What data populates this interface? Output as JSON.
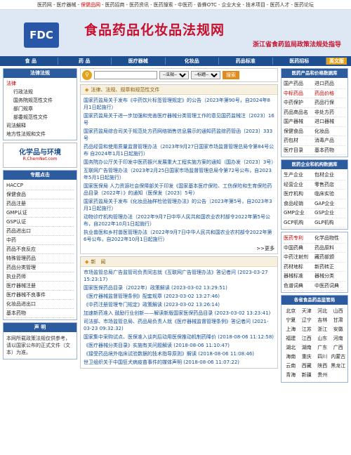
{
  "topnav": [
    "医药网",
    "医疗器械",
    "保健品网",
    "医药招商",
    "医药资讯",
    "医药搜索",
    "中医药",
    "香蜂OTC",
    "企业大全",
    "技术项目",
    "医药人才",
    "医药论坛"
  ],
  "banner": {
    "logo": "FDC",
    "title": "食品药品化妆品法规网",
    "slogan": "浙江省食药监局政策法规处指导"
  },
  "mainnav": [
    "食 品",
    "药 品",
    "医疗器械",
    "化妆品",
    "药品标准",
    "医药招标",
    "英文版"
  ],
  "left": {
    "law_title": "法律法规",
    "law_items": [
      {
        "t": "法律",
        "cls": "hdr"
      },
      {
        "t": "行政法规",
        "cls": "sub"
      },
      {
        "t": "国务院规范性文件",
        "cls": "sub"
      },
      {
        "t": "部门规章",
        "cls": "sub"
      },
      {
        "t": "部委规范性文件",
        "cls": "sub"
      },
      {
        "t": "司法解释",
        "cls": ""
      },
      {
        "t": "地方性法规和文件",
        "cls": ""
      }
    ],
    "ad_line1": "化学品与环境",
    "ad_line2": "R.ChemNet.com",
    "topic_title": "专题点击",
    "topics": [
      "HACCP",
      "保健食品",
      "药品注册",
      "GMP认证",
      "GSP认证",
      "药品进出口",
      "中药",
      "药品不良反应",
      "特殊管理药品",
      "药品分类管理",
      "执业药师",
      "医疗器械注册",
      "医疗器械不良事件",
      "化妆品进出口",
      "基本药物"
    ],
    "stmt_title": "声 明",
    "stmt_text": "本网所载政策法规仅供参考，请以国家公布的正式文件（文本）为准。"
  },
  "search": {
    "placeholder": "",
    "sel1": "--法规--",
    "sel2": "--标题--",
    "button": "搜索"
  },
  "laws": {
    "title": "法律、法规、规章和规范性文件",
    "items": [
      "国家药监局关于发布《中药饮片标签管理规定》的公告（2023年第90号，自2024年8月1日起施行）",
      "国家药监局关于进一步加强和完善医疗器械分类管理工作的意见国药监械注〔2023〕16号",
      "国家药监局综合司关于规范处方药网络销售信息展示的通知药监综药管函〔2023〕333号",
      "药品经营和使用质量监督管理办法（2023年9月27日国家市场监督管理总局令第84号公布 自2024年1月1日起施行）",
      "国务院办公厅关于印发中医药振兴发展重大工程实施方案的通知（国办发〔2023〕3号）",
      "互联网广告管理办法（2023年2月25日国家市场监督管理总局令第72号公布，自2023年5月1日起施行）",
      "国家医保局 人力资源社会保障部关于印发《国家基本医疗保险、工伤保险和生育保险药品目录（2022年）》的通知（医保发〔2023〕5号）",
      "国家药监局关于发布《化妆品抽样检验管理办法》的公告（2023年第5号，自2023年3月1日起施行）",
      "动物诊疗机构管理办法（2022年9月7日中华人民共和国农业农村部令2022年第5号公布，自2022年10月1日起施行）",
      "执业兽医和乡村兽医管理办法（2022年9月7日中华人民共和国农业农村部令2022年第6号公布，自2022年10月1日起施行）"
    ],
    "more": ">>更多"
  },
  "news": {
    "title": "新　闻",
    "items": [
      "市场监管总局广告监管司负责同志就《互联网广告管理办法》答记者问 (2023-03-27 15:23:17)",
      "国家医保药品目录（2022年）政策解读 (2023-03-02 13:29:51)",
      "《医疗器械监督管理条例》配套规章 (2023-03-02 13:27:46)",
      "《中药注册管理专门规定》政策解读 (2023-03-02 13:26:14)",
      "加速新药准入 鼓励行业创新——解读新版国家医保药品目录 (2023-03-02 13:23:41)",
      "司法部、市场监管总局、药品局负责人就《医疗器械监督管理条例》答记者问 (2021-03-23 09:32:32)",
      "国家集中采购试点、医保准入谈判后动用医保推动机制药降价 (2018-08-06 11:12:58)",
      "《医疗器械分类目录》实施有关问题解读 (2018-08-06 11:10:47)",
      "《接受药品境外临床试验数据的技术指导原则》解读 (2018-08-06 11:08:46)",
      "世卫组织关于中国狂犬病疫苗事件的媒体声明 (2018-08-06 11:07:22)"
    ]
  },
  "right": {
    "box1_title": "医药产品和价格数据库",
    "box1": [
      {
        "t": "国产药品",
        "r": false
      },
      {
        "t": "进口药品",
        "r": false
      },
      {
        "t": "中标药品",
        "r": true
      },
      {
        "t": "药品价格",
        "r": true
      },
      {
        "t": "中药保护",
        "r": false
      },
      {
        "t": "药品行保",
        "r": false
      },
      {
        "t": "药品商品名",
        "r": false
      },
      {
        "t": "非处方药",
        "r": false
      },
      {
        "t": "国产器械",
        "r": false
      },
      {
        "t": "进口器械",
        "r": false
      },
      {
        "t": "保健食品",
        "r": false
      },
      {
        "t": "化妆品",
        "r": false
      },
      {
        "t": "药包材",
        "r": false
      },
      {
        "t": "消毒产品",
        "r": false
      },
      {
        "t": "医疗目录",
        "r": false
      },
      {
        "t": "基本药物",
        "r": false
      }
    ],
    "box2_title": "医药企业和机构数据库",
    "box2": [
      {
        "t": "生产企业",
        "r": false
      },
      {
        "t": "包材企业",
        "r": false
      },
      {
        "t": "经营企业",
        "r": false
      },
      {
        "t": "零售药店",
        "r": false
      },
      {
        "t": "医疗机构",
        "r": false
      },
      {
        "t": "临床实验",
        "r": false
      },
      {
        "t": "食品经销",
        "r": false
      },
      {
        "t": "GAP企业",
        "r": false
      },
      {
        "t": "GMP企业",
        "r": false
      },
      {
        "t": "GSP企业",
        "r": false
      },
      {
        "t": "GCP机构",
        "r": false
      },
      {
        "t": "GLP机构",
        "r": false
      }
    ],
    "box3": [
      {
        "t": "医药专利",
        "r": true
      },
      {
        "t": "化学品物性",
        "r": false
      },
      {
        "t": "中国药典",
        "r": false
      },
      {
        "t": "药品原料",
        "r": false
      },
      {
        "t": "中药注射剂",
        "r": false
      },
      {
        "t": "藏药部颁",
        "r": false
      },
      {
        "t": "药材地标",
        "r": false
      },
      {
        "t": "新药转正",
        "r": false
      },
      {
        "t": "器械标准",
        "r": false
      },
      {
        "t": "器械分类",
        "r": false
      },
      {
        "t": "色谱词典",
        "r": false
      },
      {
        "t": "中医药词典",
        "r": false
      }
    ],
    "prov_title": "各省食品药品监管局",
    "provinces": [
      "北京",
      "天津",
      "河北",
      "山西",
      "宁夏",
      "辽宁",
      "吉林",
      "甘肃",
      "上海",
      "江苏",
      "浙江",
      "安徽",
      "福建",
      "江西",
      "山东",
      "河南",
      "湖北",
      "湖南",
      "广东",
      "广西",
      "海南",
      "重庆",
      "四川",
      "内蒙古",
      "云南",
      "西藏",
      "陕西",
      "黑龙江",
      "青海",
      "新疆",
      "贵州"
    ]
  }
}
